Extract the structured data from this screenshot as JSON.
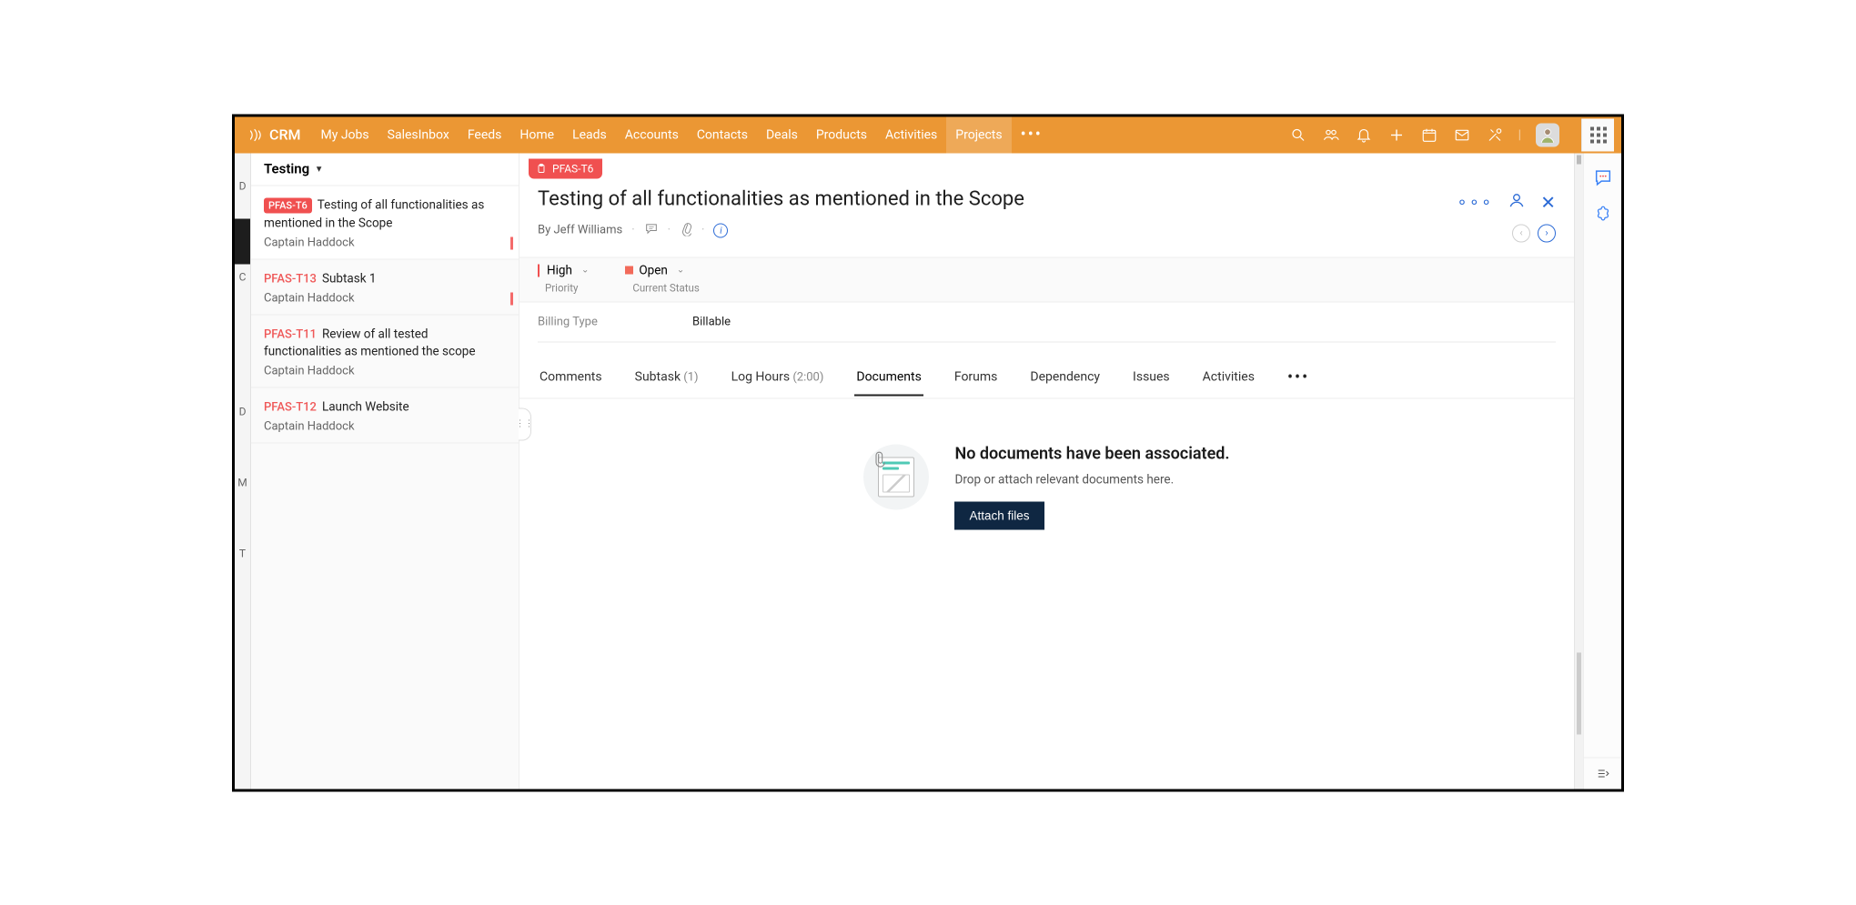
{
  "brand": "CRM",
  "nav": [
    "My Jobs",
    "SalesInbox",
    "Feeds",
    "Home",
    "Leads",
    "Accounts",
    "Contacts",
    "Deals",
    "Products",
    "Activities",
    "Projects"
  ],
  "nav_active_index": 10,
  "sidebar": {
    "group": "Testing",
    "items": [
      {
        "code": "PFAS-T6",
        "chip": true,
        "title": "Testing of all functionalities as mentioned in the Scope",
        "assignee": "Captain Haddock",
        "flag": true,
        "active": true
      },
      {
        "code": "PFAS-T13",
        "chip": false,
        "title": "Subtask 1",
        "assignee": "Captain Haddock",
        "flag": true,
        "active": false
      },
      {
        "code": "PFAS-T11",
        "chip": false,
        "title": "Review of all tested functionalities as mentioned the scope",
        "assignee": "Captain Haddock",
        "flag": false,
        "active": false
      },
      {
        "code": "PFAS-T12",
        "chip": false,
        "title": "Launch Website",
        "assignee": "Captain Haddock",
        "flag": false,
        "active": false
      }
    ]
  },
  "task": {
    "chip_code": "PFAS-T6",
    "title": "Testing of all functionalities as mentioned in the Scope",
    "author_prefix": "By ",
    "author": "Jeff Williams",
    "priority_value": "High",
    "priority_label": "Priority",
    "status_value": "Open",
    "status_label": "Current Status",
    "billing_label": "Billing Type",
    "billing_value": "Billable"
  },
  "tabs": [
    {
      "label": "Comments"
    },
    {
      "label": "Subtask",
      "count": "(1)"
    },
    {
      "label": "Log Hours",
      "count": "(2:00)"
    },
    {
      "label": "Documents",
      "active": true
    },
    {
      "label": "Forums"
    },
    {
      "label": "Dependency"
    },
    {
      "label": "Issues"
    },
    {
      "label": "Activities"
    }
  ],
  "empty_state": {
    "heading": "No documents have been associated.",
    "sub": "Drop or attach relevant documents here.",
    "button": "Attach files"
  },
  "left_gutter_chars": [
    "D",
    "",
    "C",
    "",
    "D",
    "",
    "M",
    "",
    "T"
  ]
}
